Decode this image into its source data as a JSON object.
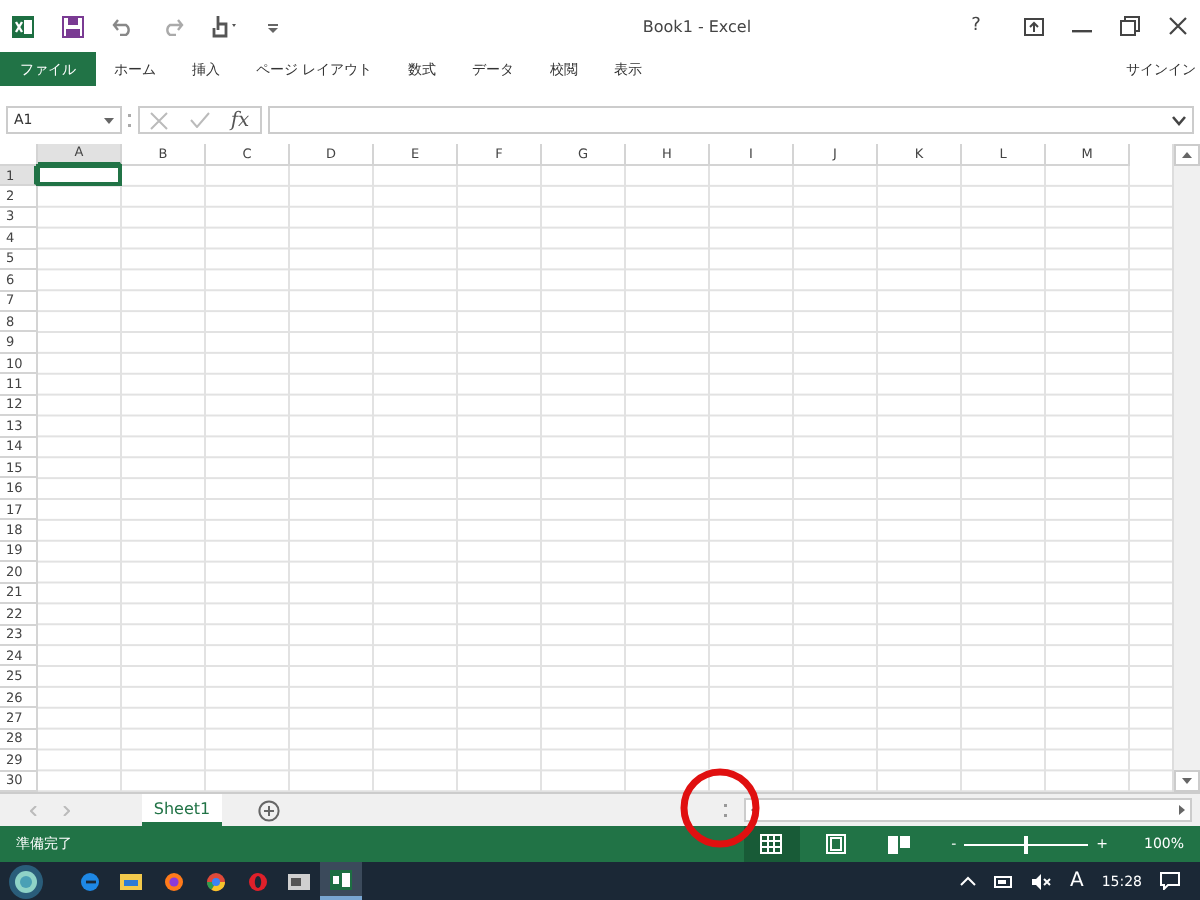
{
  "window": {
    "title": "Book1 - Excel",
    "help": "?"
  },
  "ribbon_tabs": [
    {
      "label": "ファイル",
      "kind": "file",
      "selected": false
    },
    {
      "label": "ホーム",
      "kind": "tab",
      "selected": false
    },
    {
      "label": "挿入",
      "kind": "tab",
      "selected": false
    },
    {
      "label": "ページ レイアウト",
      "kind": "tab",
      "selected": false
    },
    {
      "label": "数式",
      "kind": "tab",
      "selected": false
    },
    {
      "label": "データ",
      "kind": "tab",
      "selected": false
    },
    {
      "label": "校閲",
      "kind": "tab",
      "selected": false
    },
    {
      "label": "表示",
      "kind": "tab",
      "selected": false
    }
  ],
  "sign_in": "サインイン",
  "formula_bar": {
    "name_box": "A1",
    "fx": "fx"
  },
  "columns": [
    {
      "label": "A",
      "selected": true
    },
    {
      "label": "B",
      "selected": false
    },
    {
      "label": "C",
      "selected": false
    },
    {
      "label": "D",
      "selected": false
    },
    {
      "label": "E",
      "selected": false
    },
    {
      "label": "F",
      "selected": false
    },
    {
      "label": "G",
      "selected": false
    },
    {
      "label": "H",
      "selected": false
    },
    {
      "label": "I",
      "selected": false
    },
    {
      "label": "J",
      "selected": false
    },
    {
      "label": "K",
      "selected": false
    },
    {
      "label": "L",
      "selected": false
    },
    {
      "label": "M",
      "selected": false
    }
  ],
  "rows": [
    {
      "label": "1",
      "selected": true
    },
    {
      "label": "2",
      "selected": false
    },
    {
      "label": "3",
      "selected": false
    },
    {
      "label": "4",
      "selected": false
    },
    {
      "label": "5",
      "selected": false
    },
    {
      "label": "6",
      "selected": false
    },
    {
      "label": "7",
      "selected": false
    },
    {
      "label": "8",
      "selected": false
    },
    {
      "label": "9",
      "selected": false
    },
    {
      "label": "10",
      "selected": false
    },
    {
      "label": "11",
      "selected": false
    },
    {
      "label": "12",
      "selected": false
    },
    {
      "label": "13",
      "selected": false
    },
    {
      "label": "14",
      "selected": false
    },
    {
      "label": "15",
      "selected": false
    },
    {
      "label": "16",
      "selected": false
    },
    {
      "label": "17",
      "selected": false
    },
    {
      "label": "18",
      "selected": false
    },
    {
      "label": "19",
      "selected": false
    },
    {
      "label": "20",
      "selected": false
    },
    {
      "label": "21",
      "selected": false
    },
    {
      "label": "22",
      "selected": false
    },
    {
      "label": "23",
      "selected": false
    },
    {
      "label": "24",
      "selected": false
    },
    {
      "label": "25",
      "selected": false
    },
    {
      "label": "26",
      "selected": false
    },
    {
      "label": "27",
      "selected": false
    },
    {
      "label": "28",
      "selected": false
    },
    {
      "label": "29",
      "selected": false
    },
    {
      "label": "30",
      "selected": false
    }
  ],
  "sheet_tabs": [
    {
      "label": "Sheet1",
      "selected": true
    }
  ],
  "status_bar": {
    "text": "準備完了",
    "views": [
      {
        "kind": "normal",
        "selected": true
      },
      {
        "kind": "page_layout",
        "selected": false
      },
      {
        "kind": "page_break",
        "selected": false
      }
    ],
    "zoom": {
      "minus": "-",
      "plus": "+",
      "level": 0.5,
      "reading": "100%"
    }
  },
  "taskbar": {
    "apps": [
      {
        "kind": "edge",
        "selected": false
      },
      {
        "kind": "folder",
        "selected": false
      },
      {
        "kind": "firefox",
        "selected": false
      },
      {
        "kind": "chrome",
        "selected": false
      },
      {
        "kind": "opera",
        "selected": false
      },
      {
        "kind": "media",
        "selected": false
      },
      {
        "kind": "excel",
        "selected": true
      }
    ],
    "ime": "A",
    "time": "15:28"
  }
}
